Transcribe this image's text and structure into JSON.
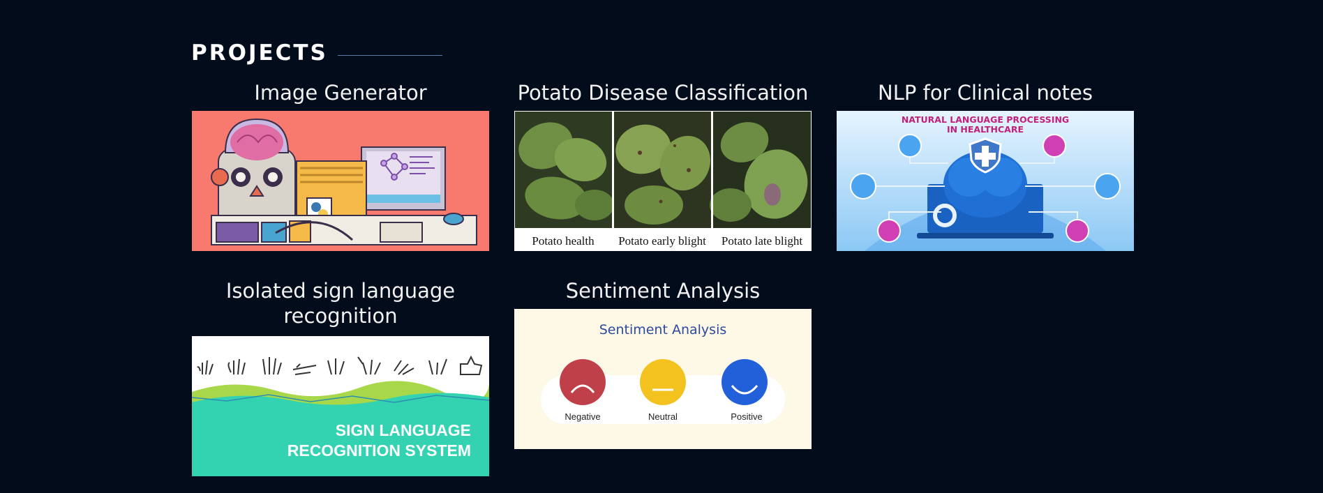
{
  "section": {
    "title": "PROJECTS"
  },
  "projects": [
    {
      "title": "Image Generator"
    },
    {
      "title": "Potato Disease Classification",
      "captions": [
        "Potato health",
        "Potato early blight",
        "Potato late blight"
      ]
    },
    {
      "title": "NLP for Clinical notes",
      "image_text": [
        "NATURAL LANGUAGE PROCESSING",
        "IN HEALTHCARE"
      ]
    },
    {
      "title": "Isolated sign language recognition",
      "image_text": [
        "SIGN LANGUAGE",
        "RECOGNITION SYSTEM"
      ]
    },
    {
      "title": "Sentiment Analysis",
      "image_title": "Sentiment Analysis",
      "labels": [
        "Negative",
        "Neutral",
        "Positive"
      ]
    }
  ],
  "colors": {
    "background": "#020c1b",
    "accent_line": "#5a7aa8",
    "image_generator_bg": "#f87a6e",
    "sign_teal": "#33d3b2",
    "sentiment_bg": "#fdf9e6"
  },
  "icons": [
    "brain-icon",
    "python-logo-icon",
    "shield-plus-icon",
    "hand-sign-icon",
    "face-icon"
  ]
}
